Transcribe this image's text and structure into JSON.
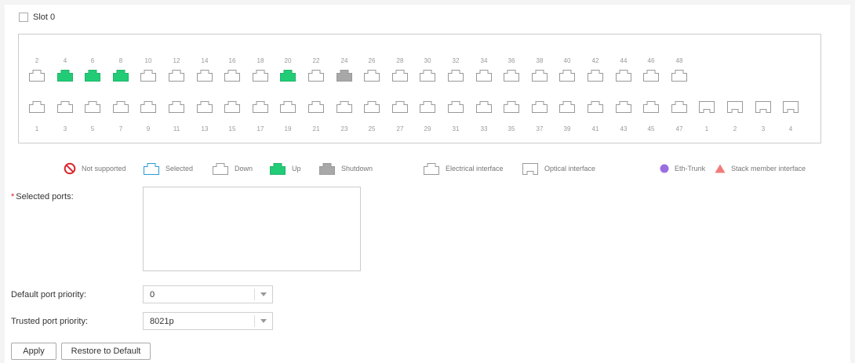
{
  "slot": {
    "label": "Slot 0",
    "checked": false
  },
  "ports": {
    "top_labels": [
      "2",
      "4",
      "6",
      "8",
      "10",
      "12",
      "14",
      "16",
      "18",
      "20",
      "22",
      "24",
      "26",
      "28",
      "30",
      "32",
      "34",
      "36",
      "38",
      "40",
      "42",
      "44",
      "46",
      "48"
    ],
    "top_states": [
      "down",
      "up",
      "up",
      "up",
      "down",
      "down",
      "down",
      "down",
      "down",
      "up",
      "down",
      "shutdown",
      "down",
      "down",
      "down",
      "down",
      "down",
      "down",
      "down",
      "down",
      "down",
      "down",
      "down",
      "down"
    ],
    "bottom_labels": [
      "1",
      "3",
      "5",
      "7",
      "9",
      "11",
      "13",
      "15",
      "17",
      "19",
      "21",
      "23",
      "25",
      "27",
      "29",
      "31",
      "33",
      "35",
      "37",
      "39",
      "41",
      "43",
      "45",
      "47"
    ],
    "bottom_states": [
      "down",
      "down",
      "down",
      "down",
      "down",
      "down",
      "down",
      "down",
      "down",
      "down",
      "down",
      "down",
      "down",
      "down",
      "down",
      "down",
      "down",
      "down",
      "down",
      "down",
      "down",
      "down",
      "down",
      "down"
    ],
    "optical_labels": [
      "1",
      "2",
      "3",
      "4"
    ],
    "optical_states": [
      "down",
      "down",
      "down",
      "down"
    ]
  },
  "legend": {
    "not_supported": "Not supported",
    "selected": "Selected",
    "down": "Down",
    "up": "Up",
    "shutdown": "Shutdown",
    "electrical": "Electrical interface",
    "optical": "Optical interface",
    "eth_trunk": "Eth-Trunk",
    "stack_member": "Stack member interface"
  },
  "form": {
    "selected_ports_label": "Selected ports:",
    "selected_ports_value": "",
    "default_priority_label": "Default port priority:",
    "default_priority_value": "0",
    "trusted_priority_label": "Trusted port priority:",
    "trusted_priority_value": "8021p"
  },
  "buttons": {
    "apply": "Apply",
    "restore": "Restore to Default"
  },
  "colors": {
    "up": "#22cc77",
    "shutdown": "#a8a8a8",
    "down_border": "#999999",
    "selected_border": "#2a9bd6",
    "not_supported": "#d9262c",
    "eth_trunk": "#9b6ee0",
    "stack_member": "#f27a7a"
  }
}
